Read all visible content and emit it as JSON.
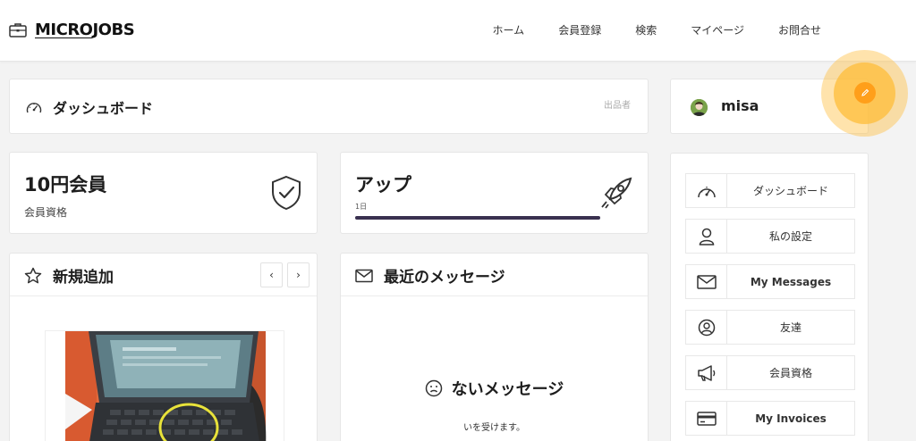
{
  "header": {
    "logo_prefix": "MICRO",
    "logo_suffix": "JOBS",
    "nav": [
      "ホーム",
      "会員登録",
      "検索",
      "マイページ",
      "お問合せ"
    ]
  },
  "dashboard": {
    "title": "ダッシュボード",
    "role": "出品者"
  },
  "membership": {
    "title": "10円会員",
    "subtitle": "会員資格"
  },
  "upgrade": {
    "title": "アップ",
    "label": "1日",
    "progress_percent": 100
  },
  "new_items": {
    "title": "新規追加",
    "prev": "‹",
    "next": "›"
  },
  "messages": {
    "title": "最近のメッセージ",
    "empty_title": "ないメッセージ",
    "empty_sub": "いを受けます。"
  },
  "user": {
    "name": "misa"
  },
  "sidebar_menu": [
    {
      "label": "ダッシュボード",
      "icon": "dashboard-icon"
    },
    {
      "label": "私の設定",
      "icon": "user-icon"
    },
    {
      "label": "My Messages",
      "icon": "envelope-icon"
    },
    {
      "label": "友達",
      "icon": "user-circle-icon"
    },
    {
      "label": "会員資格",
      "icon": "megaphone-icon"
    },
    {
      "label": "My Invoices",
      "icon": "credit-card-icon"
    }
  ],
  "colors": {
    "accent": "#ff9f1a",
    "progress": "#3a3150"
  }
}
